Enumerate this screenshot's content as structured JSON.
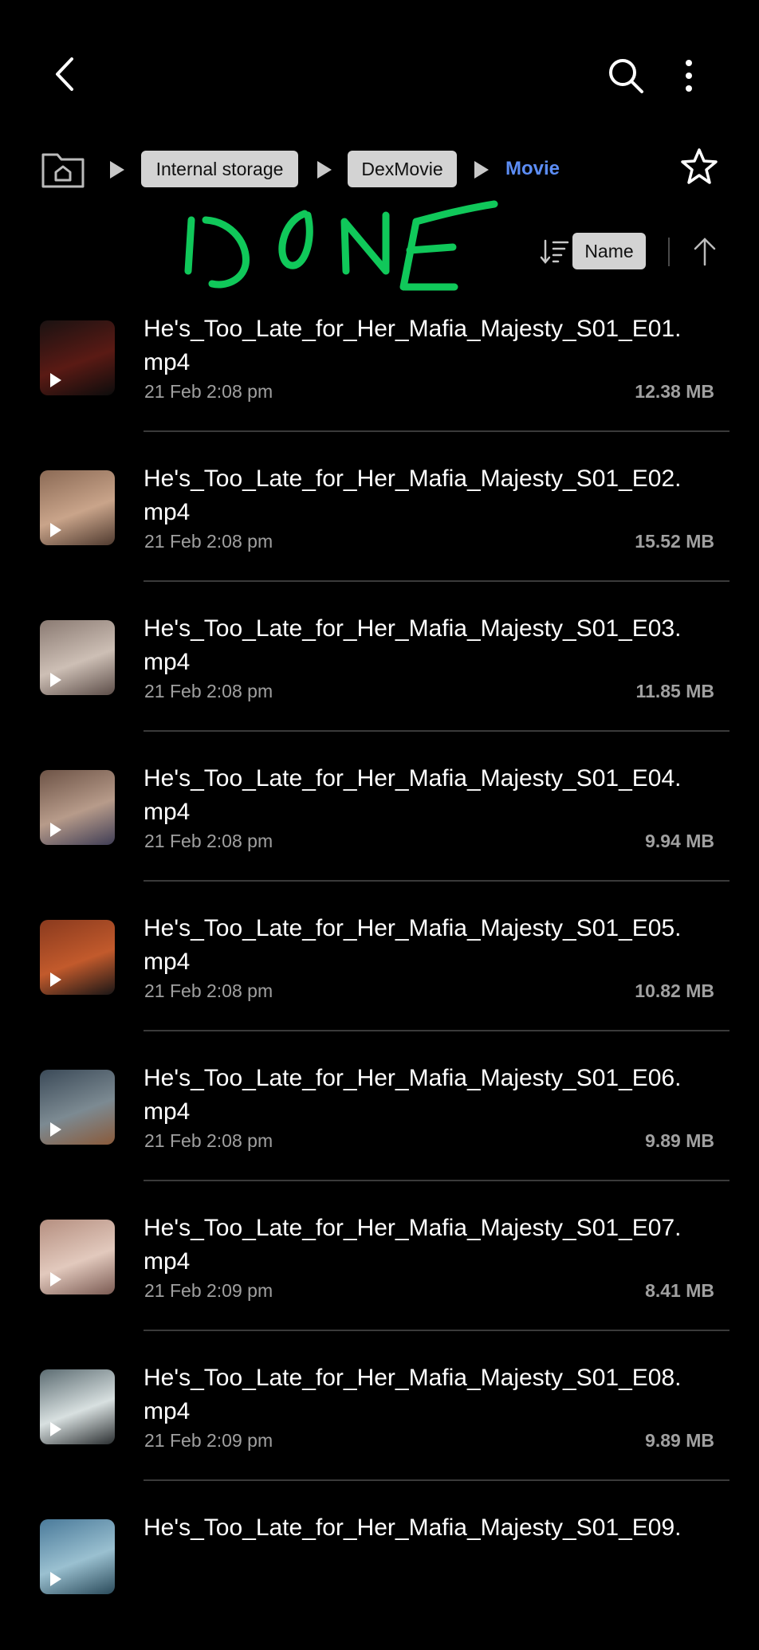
{
  "appbar": {
    "back_icon": "chevron-left-icon",
    "search_icon": "search-icon",
    "more_icon": "more-vertical-icon"
  },
  "breadcrumb": {
    "home_icon": "home-folder-icon",
    "items": [
      "Internal storage",
      "DexMovie"
    ],
    "current": "Movie",
    "favorite_icon": "star-outline-icon"
  },
  "annotation": {
    "handwritten_text": "DONE",
    "color": "#10c85a"
  },
  "sort": {
    "icon": "sort-icon",
    "label": "Name",
    "direction_icon": "arrow-up-icon"
  },
  "colors": {
    "accent": "#5c8df5",
    "chip_bg": "#d3d3d3",
    "secondary_text": "#a0a0a0"
  },
  "files": [
    {
      "name": "He's_Too_Late_for_Her_Mafia_Majesty_S01_E01.\nmp4",
      "date": "21 Feb 2:08 pm",
      "size": "12.38 MB",
      "thumb_colors": [
        "#1a1212",
        "#5a1a14",
        "#0c0c0c"
      ]
    },
    {
      "name": "He's_Too_Late_for_Her_Mafia_Majesty_S01_E02.\nmp4",
      "date": "21 Feb 2:08 pm",
      "size": "15.52 MB",
      "thumb_colors": [
        "#8b6a55",
        "#c9a48a",
        "#4f3a2f"
      ]
    },
    {
      "name": "He's_Too_Late_for_Her_Mafia_Majesty_S01_E03.\nmp4",
      "date": "21 Feb 2:08 pm",
      "size": "11.85 MB",
      "thumb_colors": [
        "#8a7a72",
        "#cdbfb5",
        "#5c4d48"
      ]
    },
    {
      "name": "He's_Too_Late_for_Her_Mafia_Majesty_S01_E04.\nmp4",
      "date": "21 Feb 2:08 pm",
      "size": "9.94 MB",
      "thumb_colors": [
        "#6d5346",
        "#b79b8a",
        "#3f3d55"
      ]
    },
    {
      "name": "He's_Too_Late_for_Her_Mafia_Majesty_S01_E05.\nmp4",
      "date": "21 Feb 2:08 pm",
      "size": "10.82 MB",
      "thumb_colors": [
        "#8a3a1e",
        "#c25a2c",
        "#1a1616"
      ]
    },
    {
      "name": "He's_Too_Late_for_Her_Mafia_Majesty_S01_E06.\nmp4",
      "date": "21 Feb 2:08 pm",
      "size": "9.89 MB",
      "thumb_colors": [
        "#3b4a58",
        "#7c8a92",
        "#8a5a3a"
      ]
    },
    {
      "name": "He's_Too_Late_for_Her_Mafia_Majesty_S01_E07.\nmp4",
      "date": "21 Feb 2:09 pm",
      "size": "8.41 MB",
      "thumb_colors": [
        "#b58f80",
        "#e2c9bd",
        "#7a5a52"
      ]
    },
    {
      "name": "He's_Too_Late_for_Her_Mafia_Majesty_S01_E08.\nmp4",
      "date": "21 Feb 2:09 pm",
      "size": "9.89 MB",
      "thumb_colors": [
        "#5c6c72",
        "#d8e0e0",
        "#2a2e30"
      ]
    },
    {
      "name": "He's_Too_Late_for_Her_Mafia_Majesty_S01_E09.",
      "date": "",
      "size": "",
      "thumb_colors": [
        "#4a7a9a",
        "#9ac0d0",
        "#2a4a5a"
      ]
    }
  ]
}
